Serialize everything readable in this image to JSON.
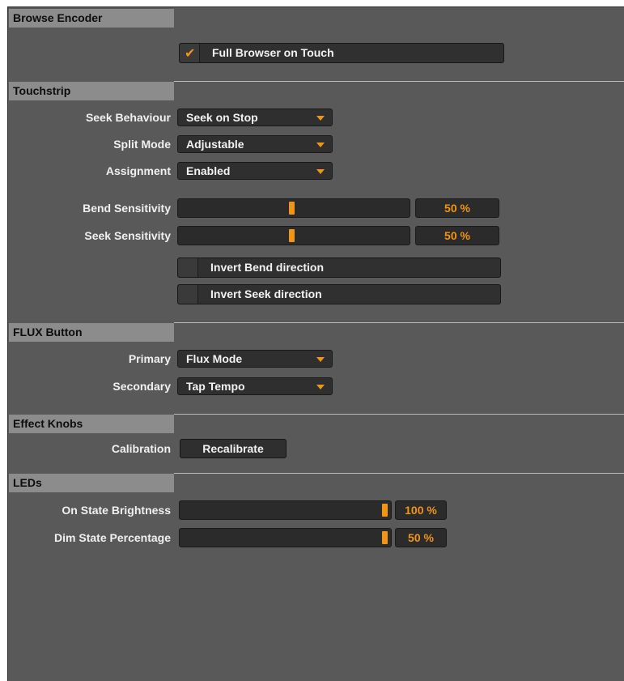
{
  "sections": {
    "browse_encoder": {
      "title": "Browse Encoder",
      "full_browser_on_touch": {
        "label": "Full Browser on Touch",
        "checked": true
      }
    },
    "touchstrip": {
      "title": "Touchstrip",
      "seek_behaviour": {
        "label": "Seek Behaviour",
        "value": "Seek on Stop"
      },
      "split_mode": {
        "label": "Split Mode",
        "value": "Adjustable"
      },
      "assignment": {
        "label": "Assignment",
        "value": "Enabled"
      },
      "bend_sensitivity": {
        "label": "Bend Sensitivity",
        "value_text": "50 %",
        "level": 0.5
      },
      "seek_sensitivity": {
        "label": "Seek Sensitivity",
        "value_text": "50 %",
        "level": 0.5
      },
      "invert_bend": {
        "label": "Invert Bend direction",
        "checked": false
      },
      "invert_seek": {
        "label": "Invert Seek direction",
        "checked": false
      }
    },
    "flux_button": {
      "title": "FLUX Button",
      "primary": {
        "label": "Primary",
        "value": "Flux Mode"
      },
      "secondary": {
        "label": "Secondary",
        "value": "Tap Tempo"
      }
    },
    "effect_knobs": {
      "title": "Effect Knobs",
      "calibration": {
        "label": "Calibration",
        "button": "Recalibrate"
      }
    },
    "leds": {
      "title": "LEDs",
      "on_state_brightness": {
        "label": "On State Brightness",
        "value_text": "100 %",
        "level": 1.0
      },
      "dim_state_percentage": {
        "label": "Dim State Percentage",
        "value_text": "50 %",
        "level": 1.0
      }
    }
  },
  "colors": {
    "accent": "#f29414",
    "panel": "#595959",
    "header": "#8c8c8c"
  }
}
